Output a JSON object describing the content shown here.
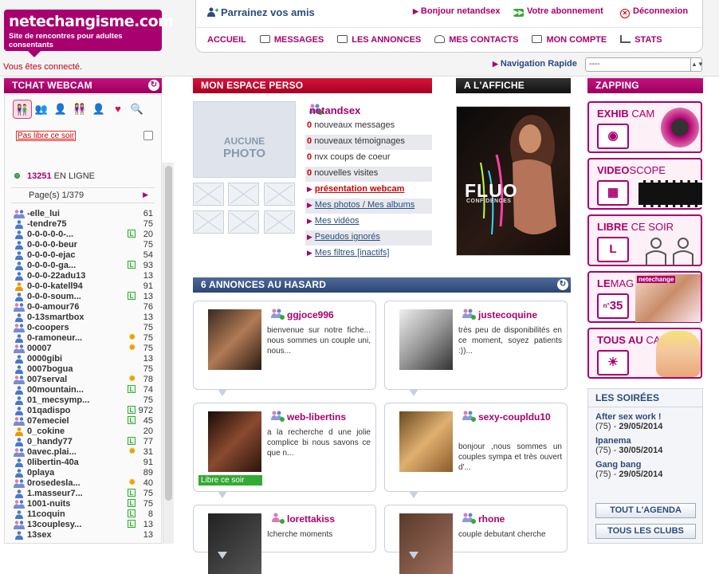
{
  "header": {
    "logo_main": "netechangisme.com",
    "logo_tagline": "Site de rencontres pour adultes consentants",
    "sponsor": "Parrainez vos amis",
    "greeting": "Bonjour netandsex",
    "subscription": "Votre abonnement",
    "logout": "Déconnexion",
    "menu": [
      "ACCUEIL",
      "MESSAGES",
      "LES ANNONCES",
      "MES CONTACTS",
      "MON COMPTE",
      "STATS"
    ],
    "connected": "Vous êtes connecté.",
    "quick_nav_label": "Navigation Rapide",
    "quick_nav_value": "----"
  },
  "chat": {
    "title": "TCHAT WEBCAM",
    "not_free": "Pas libre ce soir",
    "online_count": "13251",
    "online_label": "EN LIGNE",
    "pages": "Page(s) 1/379",
    "members": [
      {
        "name": "-elle_lui",
        "age": "61",
        "icon": "couple",
        "tag": ""
      },
      {
        "name": "-tendre75",
        "age": "75",
        "icon": "man",
        "tag": ""
      },
      {
        "name": "0-0-0-0-0-...",
        "age": "20",
        "icon": "man",
        "tag": "L"
      },
      {
        "name": "0-0-0-0-beur",
        "age": "75",
        "icon": "man",
        "tag": ""
      },
      {
        "name": "0-0-0-0-ejac",
        "age": "54",
        "icon": "man",
        "tag": ""
      },
      {
        "name": "0-0-0-0-ga...",
        "age": "93",
        "icon": "man",
        "tag": "L"
      },
      {
        "name": "0-0-0-22adu13",
        "age": "13",
        "icon": "man",
        "tag": ""
      },
      {
        "name": "0-0-0-katell94",
        "age": "91",
        "icon": "woman",
        "tag": ""
      },
      {
        "name": "0-0-0-soum...",
        "age": "13",
        "icon": "man",
        "tag": "L"
      },
      {
        "name": "0-0-amour76",
        "age": "76",
        "icon": "couple",
        "tag": ""
      },
      {
        "name": "0-13smartbox",
        "age": "13",
        "icon": "man",
        "tag": ""
      },
      {
        "name": "0-coopers",
        "age": "75",
        "icon": "couple",
        "tag": ""
      },
      {
        "name": "0-ramoneur...",
        "age": "75",
        "icon": "man",
        "tag": "S"
      },
      {
        "name": "00007",
        "age": "75",
        "icon": "couple",
        "tag": "S"
      },
      {
        "name": "0000gibi",
        "age": "13",
        "icon": "man",
        "tag": ""
      },
      {
        "name": "0007bogua",
        "age": "75",
        "icon": "man",
        "tag": ""
      },
      {
        "name": "007serval",
        "age": "78",
        "icon": "couple",
        "tag": "S"
      },
      {
        "name": "00mountain...",
        "age": "74",
        "icon": "man",
        "tag": "L"
      },
      {
        "name": "01_mecsymp...",
        "age": "75",
        "icon": "man",
        "tag": ""
      },
      {
        "name": "01qadispo",
        "age": "972",
        "icon": "man",
        "tag": "L"
      },
      {
        "name": "07emeciel",
        "age": "45",
        "icon": "couple",
        "tag": "L"
      },
      {
        "name": "0_cokine",
        "age": "20",
        "icon": "woman",
        "tag": ""
      },
      {
        "name": "0_handy77",
        "age": "77",
        "icon": "man",
        "tag": "L"
      },
      {
        "name": "0avec.plai...",
        "age": "31",
        "icon": "couple",
        "tag": "S"
      },
      {
        "name": "0libertin-40a",
        "age": "91",
        "icon": "man",
        "tag": ""
      },
      {
        "name": "0playa",
        "age": "89",
        "icon": "man",
        "tag": ""
      },
      {
        "name": "0rosedesla...",
        "age": "40",
        "icon": "couple",
        "tag": "S"
      },
      {
        "name": "1.masseur7...",
        "age": "75",
        "icon": "man",
        "tag": "L"
      },
      {
        "name": "1001-nuits",
        "age": "75",
        "icon": "couple",
        "tag": "L"
      },
      {
        "name": "11coquin",
        "age": "8",
        "icon": "man",
        "tag": "L"
      },
      {
        "name": "13couplesy...",
        "age": "13",
        "icon": "couple",
        "tag": "L"
      },
      {
        "name": "13sex",
        "age": "13",
        "icon": "man",
        "tag": ""
      }
    ]
  },
  "espace": {
    "title": "MON ESPACE PERSO",
    "no_photo_1": "AUCUNE",
    "no_photo_2": "PHOTO",
    "username": "netandsex",
    "stats": [
      {
        "count": "0",
        "label": "nouveaux messages"
      },
      {
        "count": "0",
        "label": "nouveaux témoignages"
      },
      {
        "count": "0",
        "label": "nvx coups de coeur"
      },
      {
        "count": "0",
        "label": "nouvelles visites"
      }
    ],
    "links": [
      "présentation webcam",
      "Mes photos / Mes albums",
      "Mes vidéos",
      "Pseudos ignorés",
      "Mes filtres [inactifs]"
    ]
  },
  "affiche": {
    "title": "A L'AFFICHE",
    "headline": "FLUO",
    "subline": "CONFIDENCES"
  },
  "annonces": {
    "title": "6 ANNONCES AU HASARD",
    "free_tonight": "Libre ce soir",
    "items": [
      {
        "name": "ggjoce996",
        "text": "bienvenue sur notre fiche... nous sommes un couple uni, nous..."
      },
      {
        "name": "justecoquine",
        "text": "très peu de disponibilités en ce moment, soyez patients :))..."
      },
      {
        "name": "web-libertins",
        "text": "a la recherche d une jolie complice bi nous savons ce que n..."
      },
      {
        "name": "sexy-coupldu10",
        "text": "bonjour ,nous sommes un couples sympa et très ouvert d'..."
      },
      {
        "name": "lorettakiss",
        "text": "Icherche moments"
      },
      {
        "name": "rhone",
        "text": "couple debutant cherche"
      }
    ]
  },
  "zapping": {
    "title": "ZAPPING",
    "items": [
      {
        "bold": "EXHIB",
        "rest": " CAM"
      },
      {
        "bold": "VIDEO",
        "rest": "SCOPE"
      },
      {
        "bold": "LIBRE",
        "rest": " CE SOIR"
      },
      {
        "bold": "LE",
        "rest": "MAG"
      },
      {
        "bold": "TOUS AU",
        "rest": " CAP"
      }
    ],
    "mag_brand": "netechange",
    "mag_number": "35",
    "mag_no": "n°"
  },
  "soirees": {
    "title": "LES SOIRÉES",
    "events": [
      {
        "name": "After sex work !",
        "dept": "(75) - ",
        "date": "29/05/2014"
      },
      {
        "name": "Ipanema",
        "dept": "(75) - ",
        "date": "30/05/2014"
      },
      {
        "name": "Gang bang",
        "dept": "(75) - ",
        "date": "29/05/2014"
      }
    ],
    "agenda": "TOUT L'AGENDA",
    "clubs": "TOUS LES CLUBS"
  },
  "colors": {
    "brand": "#a8006e",
    "blue": "#2a4b7c",
    "red": "#c00"
  }
}
